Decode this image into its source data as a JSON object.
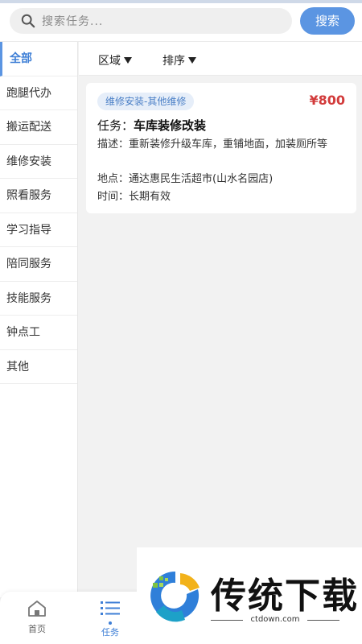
{
  "search": {
    "placeholder": "搜索任务...",
    "button_label": "搜索"
  },
  "sidebar": {
    "items": [
      {
        "label": "全部",
        "active": true
      },
      {
        "label": "跑腿代办"
      },
      {
        "label": "搬运配送"
      },
      {
        "label": "维修安装"
      },
      {
        "label": "照看服务"
      },
      {
        "label": "学习指导"
      },
      {
        "label": "陪同服务"
      },
      {
        "label": "技能服务"
      },
      {
        "label": "钟点工"
      },
      {
        "label": "其他"
      }
    ]
  },
  "filters": {
    "region": "区域",
    "sort": "排序"
  },
  "task_card": {
    "tag": "维修安装-其他维修",
    "price": "¥800",
    "task_label": "任务：",
    "task_value": "车库装修改装",
    "desc": "描述：重新装修升级车库，重铺地面，加装厕所等",
    "location": "地点：通达惠民生活超市(山水名园店)",
    "time": "时间：长期有效"
  },
  "bottom_nav": {
    "home_label": "首页",
    "tasks_label": "任务"
  },
  "watermark": {
    "text": "传统下载",
    "sub": "ctdown.com"
  },
  "colors": {
    "accent": "#5b95e2",
    "price": "#d23b3b",
    "tag_bg": "#e6eef9"
  }
}
